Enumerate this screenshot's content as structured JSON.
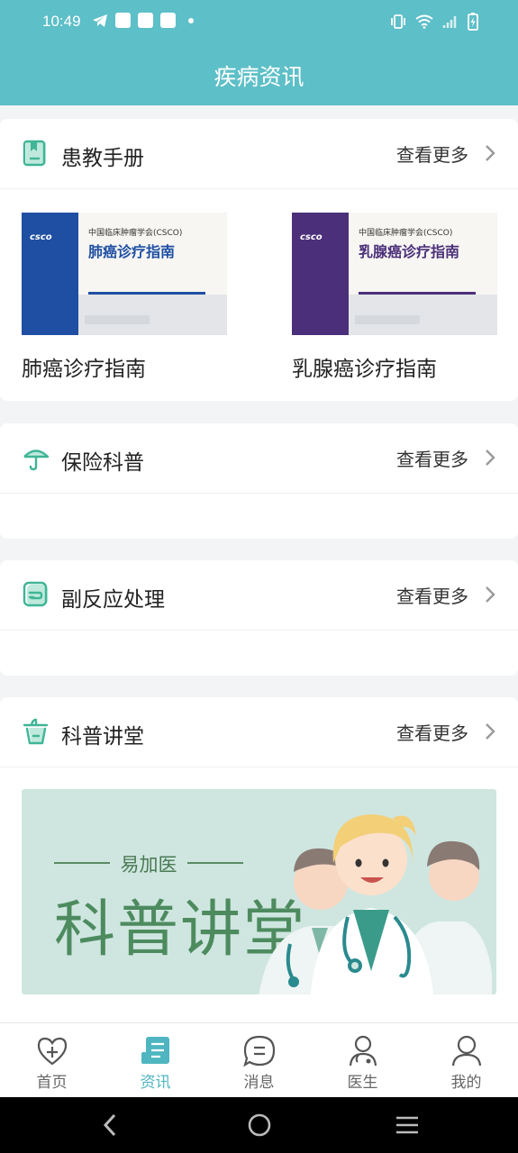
{
  "status_bar": {
    "time": "10:49"
  },
  "header": {
    "title": "疾病资讯"
  },
  "sections": {
    "handbook": {
      "label": "患教手册",
      "more": "查看更多"
    },
    "insurance": {
      "label": "保险科普",
      "more": "查看更多"
    },
    "side_effects": {
      "label": "副反应处理",
      "more": "查看更多"
    },
    "lecture": {
      "label": "科普讲堂",
      "more": "查看更多"
    }
  },
  "books": [
    {
      "title": "肺癌诊疗指南",
      "cover_org": "中国临床肿瘤学会(CSCO)",
      "cover_title": "肺癌诊疗指南",
      "cover_logo": "csco",
      "accent": "#1f4fa3"
    },
    {
      "title": "乳腺癌诊疗指南",
      "cover_org": "中国临床肿瘤学会(CSCO)",
      "cover_title": "乳腺癌诊疗指南",
      "cover_logo": "csco",
      "accent": "#4b2f7a"
    }
  ],
  "banner": {
    "brand": "易加医",
    "headline": "科普讲堂"
  },
  "tabs": [
    {
      "label": "首页",
      "icon": "heart-cross-icon"
    },
    {
      "label": "资讯",
      "icon": "news-icon",
      "active": true
    },
    {
      "label": "消息",
      "icon": "message-icon"
    },
    {
      "label": "医生",
      "icon": "doctor-icon"
    },
    {
      "label": "我的",
      "icon": "profile-icon"
    }
  ],
  "colors": {
    "primary": "#5dbfc8",
    "active_tab": "#4fb6c1",
    "icon_green": "#3fb596"
  }
}
